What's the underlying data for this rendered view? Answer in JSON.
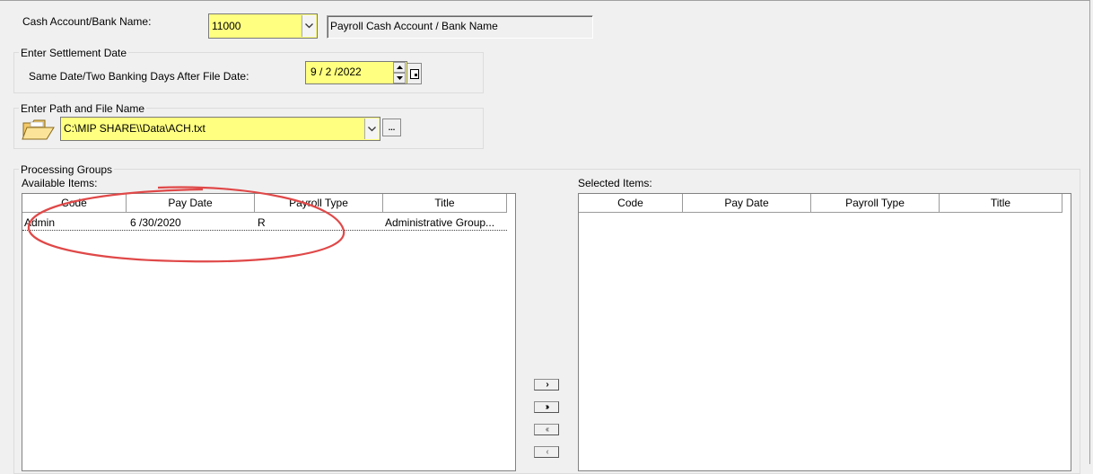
{
  "cash_account": {
    "label": "Cash Account/Bank Name:",
    "code": "11000",
    "name": "Payroll Cash Account / Bank Name"
  },
  "settlement": {
    "group_title": "Enter Settlement Date",
    "label": "Same Date/Two Banking Days After File Date:",
    "date": "9 / 2 /2022"
  },
  "file_path": {
    "group_title": "Enter Path and File Name",
    "path": "C:\\MIP SHARE\\\\Data\\ACH.txt",
    "browse_label": "..."
  },
  "processing_groups": {
    "title": "Processing Groups",
    "available_label": "Available Items:",
    "selected_label": "Selected Items:",
    "columns": [
      "Code",
      "Pay Date",
      "Payroll Type",
      "Title"
    ],
    "available_rows": [
      {
        "code": "Admin",
        "pay_date": "6 /30/2020",
        "payroll_type": "R",
        "title": "Administrative Group..."
      }
    ],
    "selected_rows": []
  },
  "transfer_buttons": {
    "add_one": "›",
    "add_all": "››",
    "remove_all": "‹‹",
    "remove_one": "‹"
  },
  "colors": {
    "highlight_field": "#ffff80",
    "annotation_circle": "#e04848"
  }
}
